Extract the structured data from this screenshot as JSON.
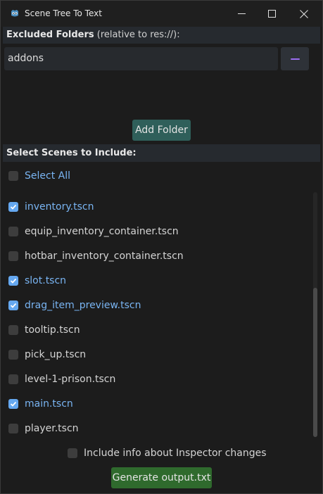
{
  "window": {
    "title": "Scene Tree To Text",
    "app_icon": "godot-icon",
    "controls": [
      "minimize-icon",
      "maximize-icon",
      "close-icon"
    ]
  },
  "excluded": {
    "label_bold": "Excluded Folders",
    "label_rest": " (relative to res://):",
    "folders": [
      {
        "value": "addons"
      }
    ],
    "remove_icon": "minus-icon",
    "add_label": "Add Folder"
  },
  "scenes": {
    "label": "Select Scenes to Include:",
    "select_all": {
      "label": "Select All",
      "checked": false
    },
    "items": [
      {
        "label": "inventory.tscn",
        "checked": true
      },
      {
        "label": "equip_inventory_container.tscn",
        "checked": false
      },
      {
        "label": "hotbar_inventory_container.tscn",
        "checked": false
      },
      {
        "label": "slot.tscn",
        "checked": true
      },
      {
        "label": "drag_item_preview.tscn",
        "checked": true
      },
      {
        "label": "tooltip.tscn",
        "checked": false
      },
      {
        "label": "pick_up.tscn",
        "checked": false
      },
      {
        "label": "level-1-prison.tscn",
        "checked": false
      },
      {
        "label": "main.tscn",
        "checked": true
      },
      {
        "label": "player.tscn",
        "checked": false
      }
    ]
  },
  "options": {
    "inspector": {
      "label": "Include info about Inspector changes",
      "checked": false
    }
  },
  "generate_label": "Generate output.txt",
  "colors": {
    "accent": "#65a8f0",
    "checked_text": "#79b4f2",
    "add_button": "#2f5f5a",
    "generate_button": "#2f6a2d",
    "remove_icon": "#9b6df2"
  }
}
